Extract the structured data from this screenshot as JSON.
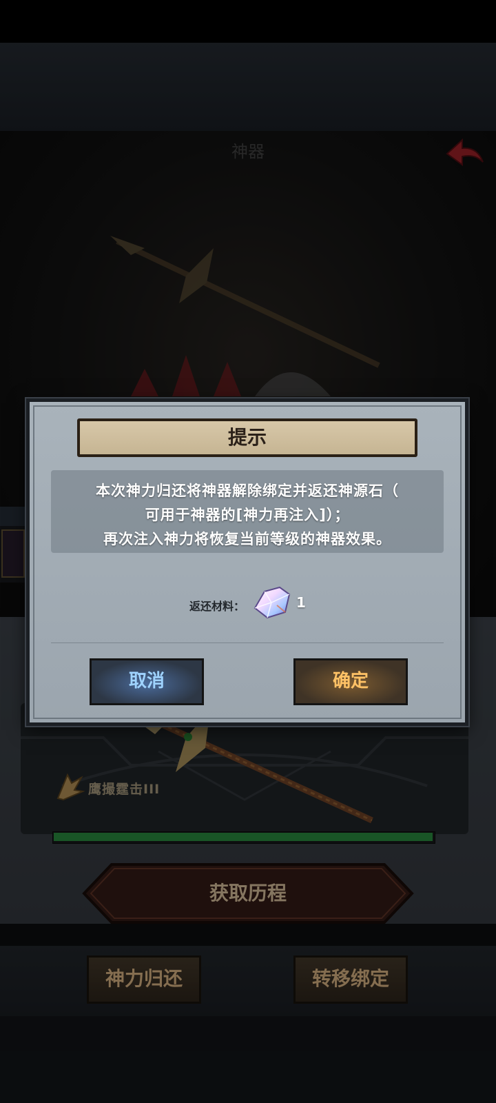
{
  "scene": {
    "title": "神器",
    "skill_name": "鹰撮霆击III",
    "progress_fraction": 1.0,
    "colors": {
      "progress": "#2f9b45",
      "back_arrow": "#b0262c"
    }
  },
  "buttons": {
    "history": "获取历程",
    "return": "神力归还",
    "transfer": "转移绑定"
  },
  "dialog": {
    "title": "提示",
    "message_lines": [
      "本次神力归还将神器解除绑定并返还神源石（",
      "可用于神器的[神力再注入]）；",
      "再次注入神力将恢复当前等级的神器效果。"
    ],
    "reward_label": "返还材料：",
    "reward_item_icon": "crystal-gem-icon",
    "reward_count": "1",
    "cancel_label": "取消",
    "confirm_label": "确定"
  }
}
